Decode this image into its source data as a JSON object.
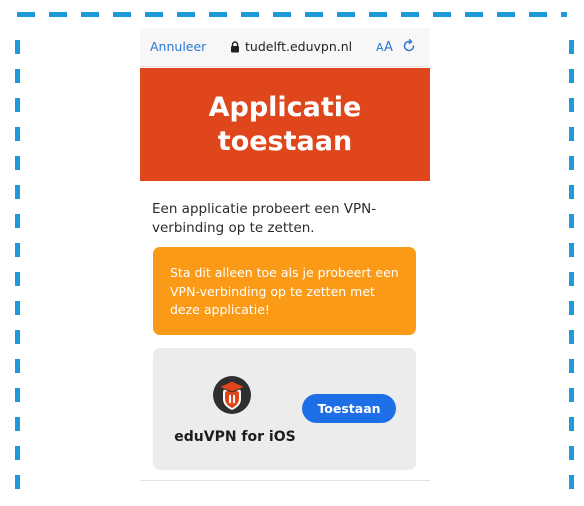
{
  "browser": {
    "cancel_label": "Annuleer",
    "url": "tudelft.eduvpn.nl",
    "reader_label_small": "A",
    "reader_label_big": "A"
  },
  "banner": {
    "title": "Applicatie toestaan",
    "color": "#e0461b"
  },
  "main": {
    "intro_text": "Een applicatie probeert een VPN-verbinding op te zetten.",
    "warning_text": "Sta dit alleen toe als je probeert een VPN-verbinding op te zetten met deze applicatie!",
    "warning_color": "#fa9a16"
  },
  "app": {
    "name": "eduVPN for iOS",
    "logo_icon": "eduvpn-graduate-icon",
    "approve_label": "Toestaan",
    "button_color": "#1e6ee8"
  },
  "frame": {
    "border_color": "#1c9ad9"
  }
}
